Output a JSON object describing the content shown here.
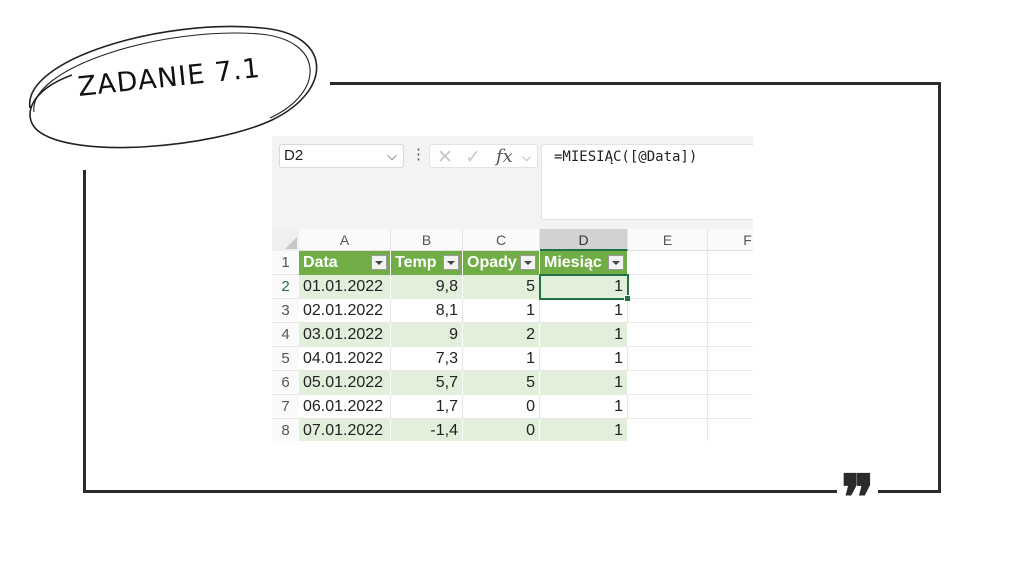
{
  "slide": {
    "title": "ZADANIE 7.1",
    "quote_glyph": "❞"
  },
  "excel": {
    "name_box": "D2",
    "name_box_chevron": "⌵",
    "more_icon": "⋮",
    "cancel_icon": "✕",
    "enter_icon": "✓",
    "fx_label": "fx",
    "fx_chevron": "⌵",
    "formula": "=MIESIĄC([@Data])",
    "columns": [
      "A",
      "B",
      "C",
      "D",
      "E",
      "F"
    ],
    "rows": [
      "1",
      "2",
      "3",
      "4",
      "5",
      "6",
      "7",
      "8"
    ],
    "table": {
      "headers": [
        "Data",
        "Temp",
        "Opady",
        "Miesiąc"
      ],
      "data": [
        [
          "01.01.2022",
          "9,8",
          "5",
          "1"
        ],
        [
          "02.01.2022",
          "8,1",
          "1",
          "1"
        ],
        [
          "03.01.2022",
          "9",
          "2",
          "1"
        ],
        [
          "04.01.2022",
          "7,3",
          "1",
          "1"
        ],
        [
          "05.01.2022",
          "5,7",
          "5",
          "1"
        ],
        [
          "06.01.2022",
          "1,7",
          "0",
          "1"
        ],
        [
          "07.01.2022",
          "-1,4",
          "0",
          "1"
        ]
      ]
    },
    "colors": {
      "header_green": "#70ad47",
      "band_green": "#e2efda",
      "selection": "#217346"
    }
  }
}
